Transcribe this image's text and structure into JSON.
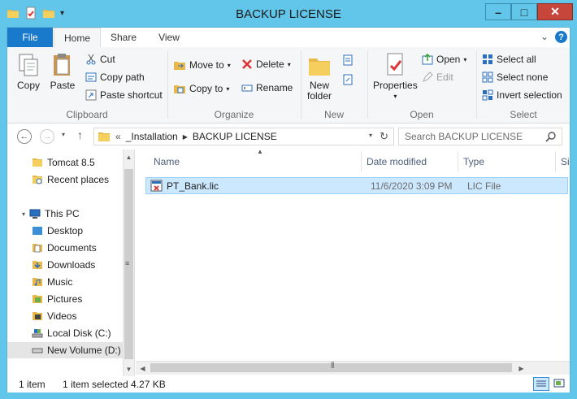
{
  "window": {
    "title": "BACKUP LICENSE",
    "minimize": "–",
    "maximize": "□",
    "close": "✕"
  },
  "ribbon_tabs": {
    "file": "File",
    "home": "Home",
    "share": "Share",
    "view": "View",
    "help": "?"
  },
  "clipboard": {
    "copy": "Copy",
    "paste": "Paste",
    "cut": "Cut",
    "copy_path": "Copy path",
    "paste_shortcut": "Paste shortcut",
    "label": "Clipboard"
  },
  "organize": {
    "move_to": "Move to",
    "copy_to": "Copy to",
    "delete": "Delete",
    "rename": "Rename",
    "label": "Organize"
  },
  "new_group": {
    "new_folder_line1": "New",
    "new_folder_line2": "folder",
    "label": "New"
  },
  "open_group": {
    "properties": "Properties",
    "open": "Open",
    "edit": "Edit",
    "label": "Open"
  },
  "select_group": {
    "select_all": "Select all",
    "select_none": "Select none",
    "invert": "Invert selection",
    "label": "Select"
  },
  "address": {
    "overflow": "«",
    "crumb1": "_Installation",
    "sep": "▶",
    "crumb2": "BACKUP LICENSE"
  },
  "search": {
    "placeholder": "Search BACKUP LICENSE"
  },
  "nav": {
    "tomcat": "Tomcat 8.5",
    "recent": "Recent places",
    "thispc": "This PC",
    "desktop": "Desktop",
    "documents": "Documents",
    "downloads": "Downloads",
    "music": "Music",
    "pictures": "Pictures",
    "videos": "Videos",
    "localdisk": "Local Disk (C:)",
    "newvolume": "New Volume (D:)"
  },
  "columns": {
    "name": "Name",
    "date": "Date modified",
    "type": "Type",
    "size": "Size"
  },
  "file": {
    "name": "PT_Bank.lic",
    "date": "11/6/2020 3:09 PM",
    "type": "LIC File"
  },
  "status": {
    "count": "1 item",
    "selected": "1 item selected  4.27 KB"
  },
  "colors": {
    "titlebar": "#62c6ea",
    "file_tab": "#1979ca",
    "selection": "#cce8ff"
  }
}
